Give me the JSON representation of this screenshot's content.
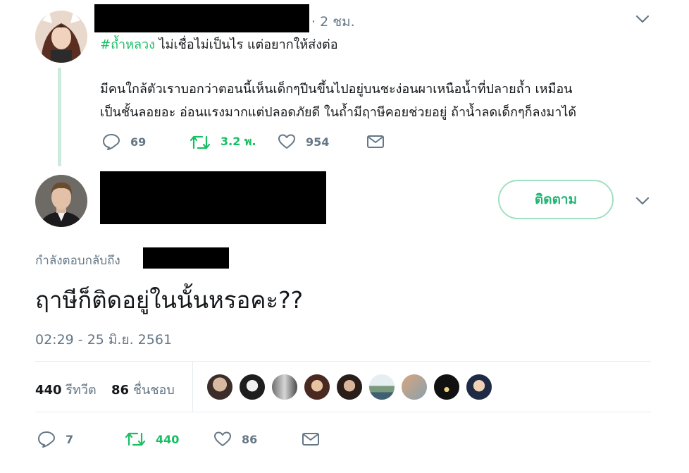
{
  "tweet1": {
    "time_ago": "· 2 ชม.",
    "hashtag": "#ถ้ำหลวง",
    "line1_rest": " ไม่เชื่อไม่เป็นไร แต่อยากให้ส่งต่อ",
    "body_line1": "มีคนใกล้ตัวเราบอกว่าตอนนี้เห็นเด็กๆปีนขึ้นไปอยู่บนชะง่อนผาเหนือน้ำที่ปลายถ้ำ เหมือน",
    "body_line2": "เป็นชั้นลอยอะ อ่อนแรงมากแต่ปลอดภัยดี ในถ้ำมีฤาษีคอยช่วยอยู่ ถ้าน้ำลดเด็กๆก็ลงมาได้",
    "reply_count": "69",
    "retweet_count": "3.2 พ.",
    "like_count": "954",
    "hashtag_color": "#17bf63"
  },
  "tweet2": {
    "follow_label": "ติดตาม",
    "replying_to": "กำลังตอบกลับถึง",
    "text": "ฤาษีก็ติดอยู่ในนั้นหรอคะ??",
    "timestamp": "02:29 - 25 มิ.ย. 2561",
    "retweets_num": "440",
    "retweets_label": "รีทวีต",
    "likes_num": "86",
    "likes_label": "ชื่นชอบ",
    "reply_count": "7",
    "retweet_count": "440",
    "like_count": "86"
  },
  "icons": {
    "reply": "reply-icon",
    "retweet": "retweet-icon",
    "like": "heart-icon",
    "dm": "envelope-icon",
    "caret": "chevron-down-icon"
  },
  "colors": {
    "accent_green": "#17bf63",
    "muted": "#657786",
    "follow_border": "#9ee1c1"
  }
}
